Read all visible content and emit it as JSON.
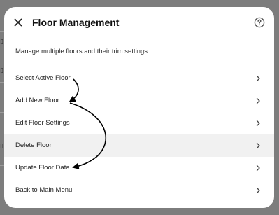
{
  "dialog": {
    "title": "Floor Management",
    "subtitle": "Manage multiple floors and their trim settings",
    "close_icon": "close-icon",
    "help_icon": "help-circle-icon"
  },
  "menu": {
    "items": [
      {
        "label": "Select Active Floor",
        "icon": "chevron-right-icon"
      },
      {
        "label": "Add New Floor",
        "icon": "chevron-right-icon"
      },
      {
        "label": "Edit Floor Settings",
        "icon": "chevron-right-icon"
      },
      {
        "label": "Delete Floor",
        "icon": "chevron-right-icon",
        "highlighted": true
      },
      {
        "label": "Update Floor Data",
        "icon": "chevron-right-icon"
      },
      {
        "label": "Back to Main Menu",
        "icon": "chevron-right-icon"
      }
    ]
  },
  "colors": {
    "overlay": "#7d7d7d",
    "dialog_bg": "#ffffff",
    "highlight_row": "#f1f1f1",
    "annotation_arrow": "#000000"
  }
}
